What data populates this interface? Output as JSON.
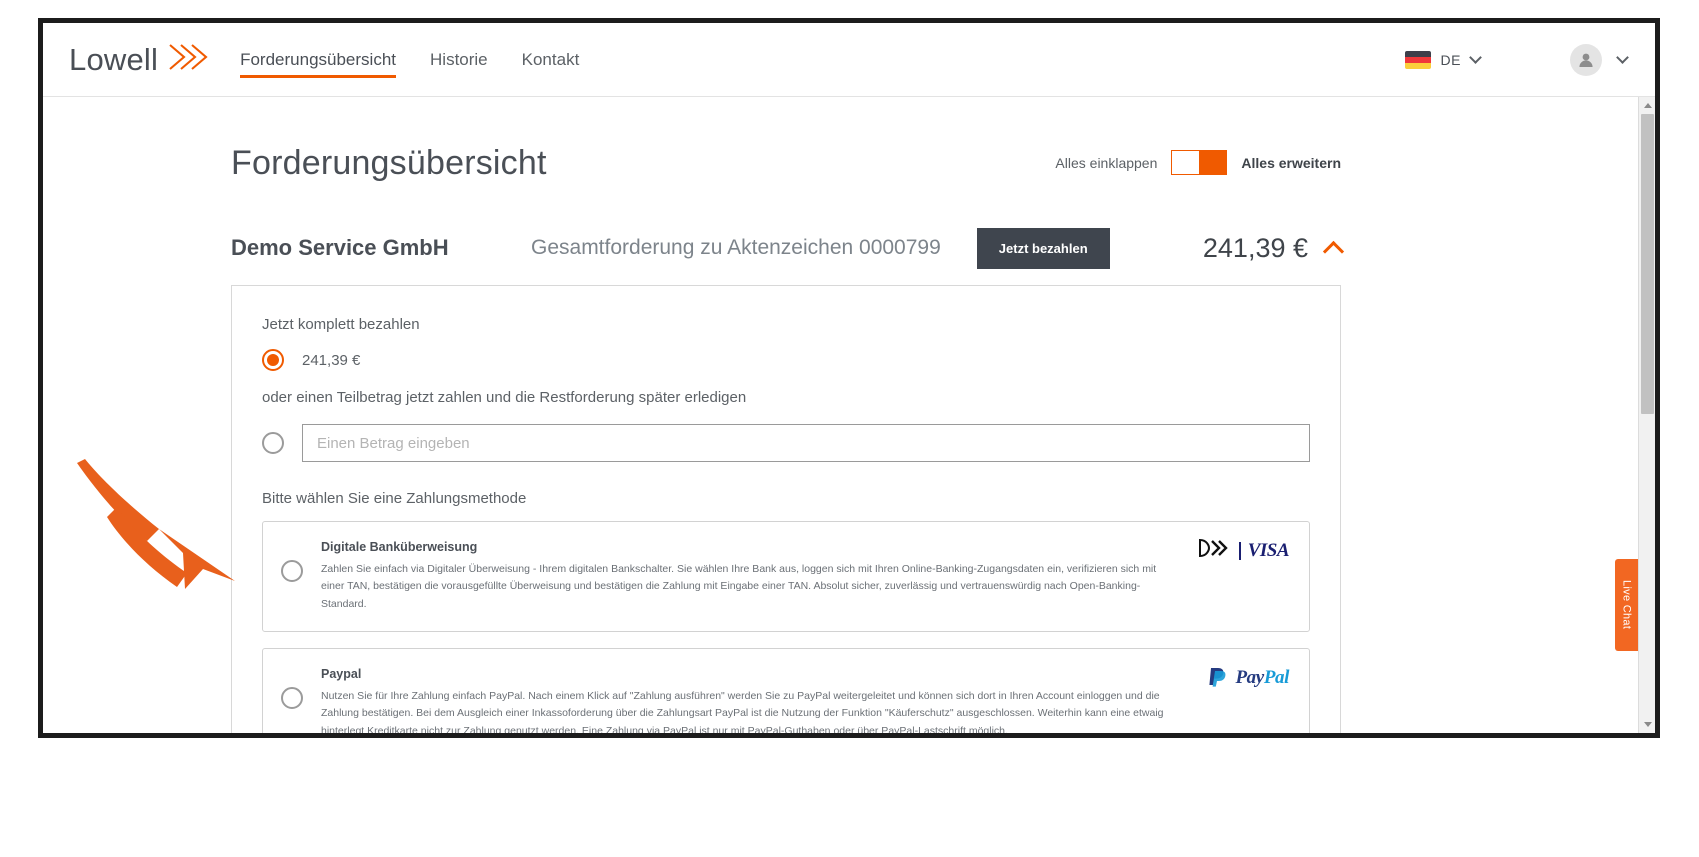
{
  "header": {
    "brand": "Lowell",
    "brand_mark_icon": "lowell-chevrons-icon",
    "nav": [
      {
        "label": "Forderungsübersicht",
        "active": true
      },
      {
        "label": "Historie",
        "active": false
      },
      {
        "label": "Kontakt",
        "active": false
      }
    ],
    "language": {
      "code": "DE",
      "flag_icon": "german-flag-icon",
      "chevron_icon": "chevron-down-icon"
    },
    "account": {
      "avatar_icon": "user-avatar-icon",
      "chevron_icon": "chevron-down-icon"
    }
  },
  "page": {
    "title": "Forderungsübersicht",
    "collapse_all_label": "Alles einklappen",
    "expand_all_label": "Alles erweitern"
  },
  "claim": {
    "creditor": "Demo Service GmbH",
    "reference_text": "Gesamtforderung zu Aktenzeichen 0000799",
    "pay_now_label": "Jetzt bezahlen",
    "total_amount": "241,39 €",
    "collapse_icon": "chevron-up-icon"
  },
  "payment": {
    "full_payment_label": "Jetzt komplett bezahlen",
    "full_amount_option": "241,39 €",
    "full_amount_selected": true,
    "partial_payment_label": "oder einen Teilbetrag jetzt zahlen und die Restforderung später erledigen",
    "partial_amount_placeholder": "Einen Betrag eingeben",
    "partial_amount_value": "",
    "partial_amount_selected": false,
    "method_prompt": "Bitte wählen Sie eine Zahlungsmethode",
    "methods": [
      {
        "id": "digitale-bankueberweisung",
        "title": "Digitale Banküberweisung",
        "description": "Zahlen Sie einfach via Digitaler Überweisung - Ihrem digitalen Bankschalter. Sie wählen Ihre Bank aus, loggen sich mit Ihren Online-Banking-Zugangsdaten ein, verifizieren sich mit einer TAN, bestätigen die vorausgefüllte Überweisung und bestätigen die Zahlung mit Eingabe einer TAN. Absolut sicher, zuverlässig und vertrauenswürdig nach Open-Banking-Standard.",
        "selected": false,
        "logos": [
          "digital-transfer-icon",
          "visa-logo"
        ],
        "visa_label": "VISA"
      },
      {
        "id": "paypal",
        "title": "Paypal",
        "description": "Nutzen Sie für Ihre Zahlung einfach PayPal. Nach einem Klick auf \"Zahlung ausführen\" werden Sie zu PayPal weitergeleitet und können sich dort in Ihren Account einloggen und die Zahlung bestätigen. Bei dem Ausgleich einer Inkassoforderung über die Zahlungsart PayPal ist die Nutzung der Funktion \"Käuferschutz\" ausgeschlossen. Weiterhin kann eine etwaig hinterlegt Kreditkarte nicht zur Zahlung genutzt werden. Eine Zahlung via PayPal ist nur mit PayPal-Guthaben oder über PayPal-Lastschrift möglich.",
        "selected": false,
        "logos": [
          "paypal-logo"
        ],
        "paypal_label_a": "Pay",
        "paypal_label_b": "Pal"
      }
    ]
  },
  "live_chat": {
    "label": "Live Chat"
  },
  "colors": {
    "brand_orange": "#f05a00",
    "chat_orange": "#f26722",
    "dark_button": "#3f454e",
    "text_gray": "#5c6166",
    "visa_blue": "#1a1f71"
  },
  "annotation": {
    "icon": "orange-arrow-annotation"
  }
}
